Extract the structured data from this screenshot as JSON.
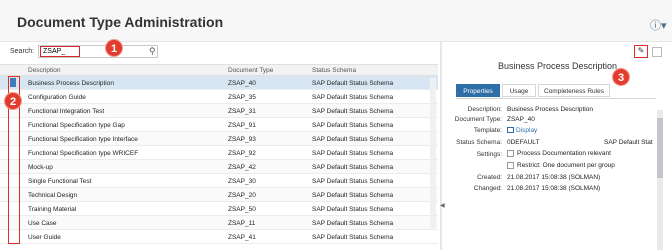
{
  "app": {
    "title": "Document Type Administration",
    "help_icon": "help-icon"
  },
  "search": {
    "label": "Search:",
    "value": "ZSAP_",
    "icon": "search-icon"
  },
  "table": {
    "headers": [
      "Description",
      "Document Type",
      "Status Schema"
    ],
    "rows": [
      {
        "description": "Business Process Description",
        "type": "ZSAP_40",
        "schema": "SAP Default Status Schema",
        "selected": true
      },
      {
        "description": "Configuration Guide",
        "type": "ZSAP_35",
        "schema": "SAP Default Status Schema"
      },
      {
        "description": "Functional Integration Test",
        "type": "ZSAP_31",
        "schema": "SAP Default Status Schema"
      },
      {
        "description": "Functional Specification type Gap",
        "type": "ZSAP_91",
        "schema": "SAP Default Status Schema"
      },
      {
        "description": "Functional Specification type Interface",
        "type": "ZSAP_93",
        "schema": "SAP Default Status Schema"
      },
      {
        "description": "Functional Specification type WRICEF",
        "type": "ZSAP_92",
        "schema": "SAP Default Status Schema"
      },
      {
        "description": "Mock-up",
        "type": "ZSAP_42",
        "schema": "SAP Default Status Schema"
      },
      {
        "description": "Single Functional Test",
        "type": "ZSAP_30",
        "schema": "SAP Default Status Schema"
      },
      {
        "description": "Technical Design",
        "type": "ZSAP_20",
        "schema": "SAP Default Status Schema"
      },
      {
        "description": "Training Material",
        "type": "ZSAP_50",
        "schema": "SAP Default Status Schema"
      },
      {
        "description": "Use Case",
        "type": "ZSAP_11",
        "schema": "SAP Default Status Schema"
      },
      {
        "description": "User Guide",
        "type": "ZSAP_41",
        "schema": "SAP Default Status Schema"
      }
    ]
  },
  "annotations": {
    "one": "1",
    "two": "2",
    "three": "3"
  },
  "detail": {
    "title": "Business Process Description",
    "tabs": [
      "Properties",
      "Usage",
      "Completeness Rules"
    ],
    "fields": {
      "description_label": "Description:",
      "description_value": "Business Process Description",
      "doctype_label": "Document Type:",
      "doctype_value": "ZSAP_40",
      "template_label": "Template:",
      "template_value": "Display",
      "schema_label": "Status Schema:",
      "schema_value": "0DEFAULT",
      "schema_extra": "SAP Default Stat",
      "settings_label": "Settings:",
      "setting_1": "Process Documentation relevant",
      "setting_2": "Restrict: One document per group",
      "created_label": "Created:",
      "created_value": "21.08.2017 15:08:38 (SOLMAN)",
      "changed_label": "Changed:",
      "changed_value": "21.08.2017 15:08:38 (SOLMAN)"
    }
  },
  "colors": {
    "accent": "#2f6fa8",
    "highlight": "#e03024",
    "selected_row": "#d8e6f3"
  }
}
